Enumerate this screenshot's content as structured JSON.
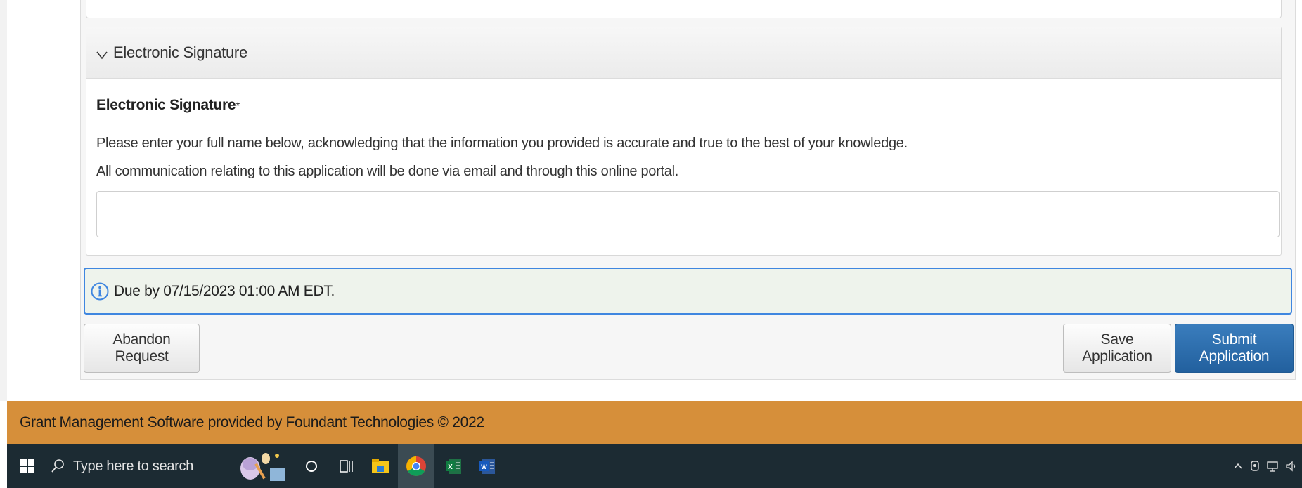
{
  "panel": {
    "title": "Electronic Signature",
    "expanded": true
  },
  "field": {
    "label": "Electronic Signature",
    "required_mark": "*",
    "help_line_1": "Please enter your full name below, acknowledging that the information you provided is accurate and true to the best of your knowledge.",
    "help_line_2": "All communication relating to this application will be done via email and through this online portal.",
    "value": "",
    "placeholder": ""
  },
  "notice": {
    "due_text": "Due by 07/15/2023 01:00 AM EDT.",
    "icon": "info-icon"
  },
  "actions": {
    "abandon_label": "Abandon Request",
    "save_label": "Save Application",
    "submit_label": "Submit Application"
  },
  "footer": {
    "text": "Grant Management Software provided by Foundant Technologies © 2022"
  },
  "taskbar": {
    "search_placeholder": "Type here to search",
    "apps": [
      "windows-start-icon",
      "search-icon",
      "cortana-icon",
      "task-view-icon",
      "file-explorer-icon",
      "chrome-icon",
      "excel-icon",
      "word-icon"
    ],
    "tray_icons": [
      "chevron-up-icon",
      "meet-now-icon",
      "network-icon",
      "volume-icon"
    ]
  },
  "colors": {
    "accent_blue": "#3f86e0",
    "primary_button": "#22609e",
    "footer_orange": "#d68f3a",
    "taskbar_bg": "#1c2b33"
  }
}
